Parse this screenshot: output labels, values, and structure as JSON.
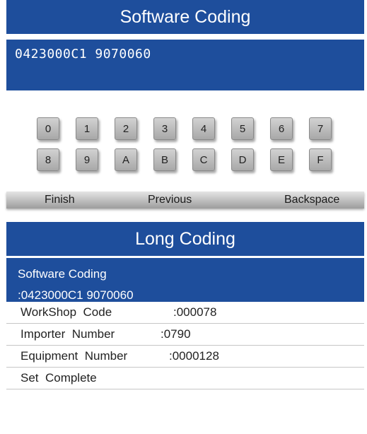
{
  "top": {
    "title": "Software Coding",
    "code_value": "0423000C1 9070060"
  },
  "keypad": {
    "row1": [
      "0",
      "1",
      "2",
      "3",
      "4",
      "5",
      "6",
      "7"
    ],
    "row2": [
      "8",
      "9",
      "A",
      "B",
      "C",
      "D",
      "E",
      "F"
    ]
  },
  "bar": {
    "finish": "Finish",
    "previous": "Previous",
    "backspace": "Backspace"
  },
  "long_coding": {
    "title": "Long Coding",
    "selected_label": "Software Coding",
    "selected_value": ":0423000C1 9070060",
    "rows": [
      {
        "label": "WorkShop  Code",
        "value": ":000078"
      },
      {
        "label": "Importer  Number",
        "value": ":0790"
      },
      {
        "label": "Equipment  Number",
        "value": ":0000128"
      },
      {
        "label": "Set  Complete",
        "value": ""
      }
    ]
  },
  "colors": {
    "header_blue": "#1e4e9c",
    "key_gray": "#b8b8b8"
  }
}
